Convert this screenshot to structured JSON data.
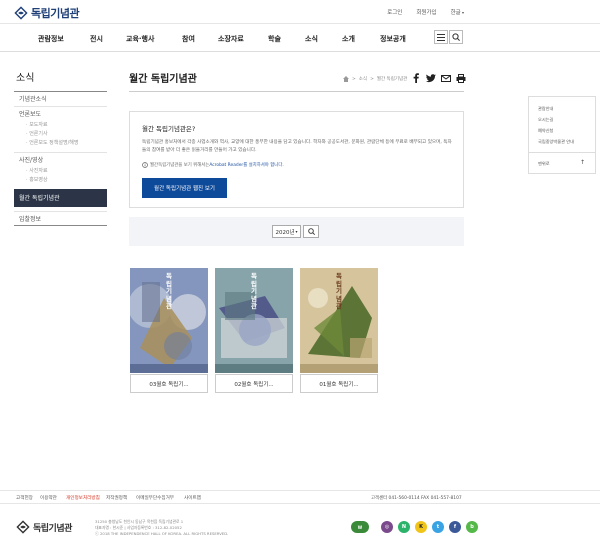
{
  "header": {
    "logo_text": "독립기념관",
    "utility": [
      "로그인",
      "회원가입",
      "한글"
    ]
  },
  "gnb": {
    "items": [
      "관람정보",
      "전시",
      "교육·행사",
      "참여",
      "소장자료",
      "학술",
      "소식",
      "소개",
      "정보공개"
    ]
  },
  "lnb": {
    "title": "소식",
    "items": [
      {
        "label": "기념관소식"
      },
      {
        "label": "언론보도",
        "subs": [
          "보도자료",
          "언론기사",
          "언론보도 정책설명/해명"
        ]
      },
      {
        "label": "사진/영상",
        "subs": [
          "사진자료",
          "홍보영상"
        ]
      },
      {
        "label": "월간 독립기념관",
        "active": true
      },
      {
        "label": "입찰정보"
      }
    ]
  },
  "content": {
    "page_title": "월간 독립기념관",
    "breadcrumb": [
      "소식",
      "월간 독립기념관"
    ],
    "info_title": "월간 독립기념관은?",
    "info_desc": "독립기념관 홍보처에서 각종 사업소개와 역사, 교양에 대한 풍부한 내용을 담고 있습니다. 학자와 공공도서관, 문화원, 관람단체 등에 무료로 배부되고 있으며, 독자들의 참여를 받아 더 좋은 읽을거리를 만들어 가고 있습니다.",
    "info_note_pre": "월간독립기념관을 보기 위해서는 ",
    "info_note_link": "Acrobat Reader를 설치하셔야 합니다.",
    "webzine_button": "월간 독립기념관 웹진 보기",
    "year": "2020년",
    "books": [
      {
        "label": "03월호 독립기...",
        "cover_title": "독립기념관",
        "bg": "#7a8fb5"
      },
      {
        "label": "02월호 독립기...",
        "cover_title": "독립기념관",
        "bg": "#7d9a9e"
      },
      {
        "label": "01월호 독립기...",
        "cover_title": "독립기념관",
        "bg": "#cdbb8f"
      }
    ]
  },
  "quick_menu": {
    "items": [
      "관람안내",
      "오시는길",
      "예약신청",
      "국립중앙박물관 안내"
    ],
    "top_label": "맨위로"
  },
  "footer": {
    "links": [
      "고객헌장",
      "이용약관",
      "개인정보처리방침",
      "저작권정책",
      "이메일무단수집거부",
      "사이트맵"
    ],
    "phone": "고객센터 041-560-0114    FAX 041-557-8107",
    "address_lines": [
      "31250 충청남도 천안시 동남구 목천읍 독립기념관로 1",
      "대표자명 : 한시준 | 사업자등록번호 : 312-82-02052",
      "ⓒ 2018 THE INDEPENDENCE HALL OF KOREA. ALL RIGHTS RESERVED."
    ],
    "logo_text": "독립기념관"
  },
  "colors": {
    "brand": "#1e3f78",
    "button": "#0e4a9a",
    "active_nav": "#2b3547",
    "privacy_link": "#d4301e"
  }
}
